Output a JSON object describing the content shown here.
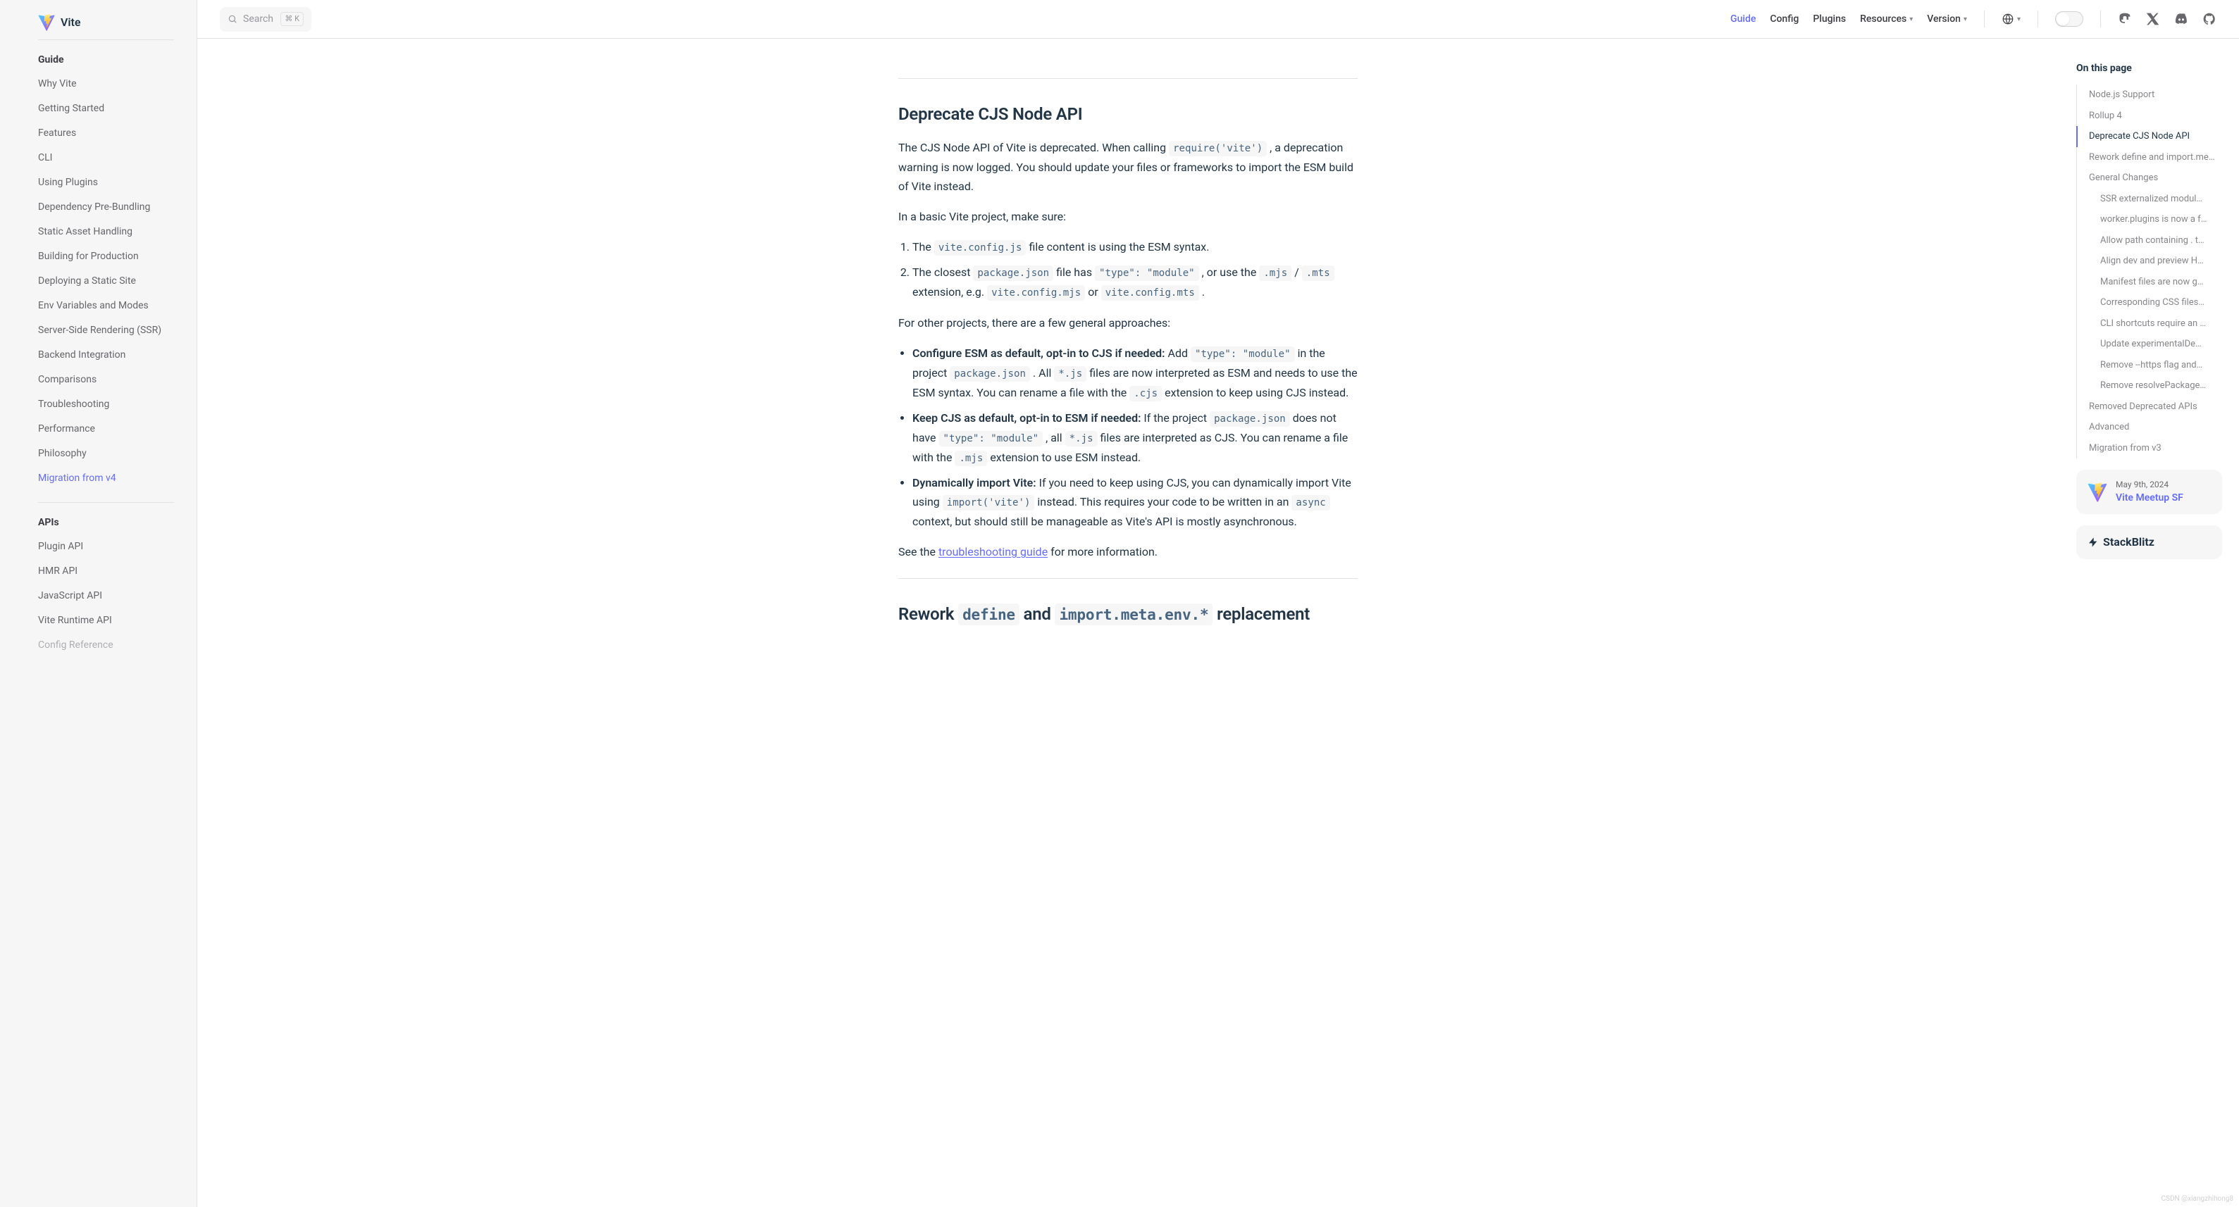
{
  "brand": "Vite",
  "search": {
    "placeholder": "Search",
    "kbd": "⌘ K"
  },
  "topnav": {
    "guide": "Guide",
    "config": "Config",
    "plugins": "Plugins",
    "resources": "Resources",
    "version": "Version"
  },
  "sidebar": {
    "group1": "Guide",
    "items1": [
      "Why Vite",
      "Getting Started",
      "Features",
      "CLI",
      "Using Plugins",
      "Dependency Pre-Bundling",
      "Static Asset Handling",
      "Building for Production",
      "Deploying a Static Site",
      "Env Variables and Modes",
      "Server-Side Rendering (SSR)",
      "Backend Integration",
      "Comparisons",
      "Troubleshooting",
      "Performance",
      "Philosophy",
      "Migration from v4"
    ],
    "active1": 16,
    "group2": "APIs",
    "items2": [
      "Plugin API",
      "HMR API",
      "JavaScript API",
      "Vite Runtime API",
      "Config Reference"
    ]
  },
  "article": {
    "h2a": "Deprecate CJS Node API",
    "p1a": "The CJS Node API of Vite is deprecated. When calling ",
    "p1_code1": "require('vite')",
    "p1b": " , a deprecation warning is now logged. You should update your files or frameworks to import the ESM build of Vite instead.",
    "p2": "In a basic Vite project, make sure:",
    "ol1_a": "The ",
    "ol1_code": "vite.config.js",
    "ol1_b": " file content is using the ESM syntax.",
    "ol2_a": "The closest ",
    "ol2_code1": "package.json",
    "ol2_b": " file has ",
    "ol2_code2": "\"type\": \"module\"",
    "ol2_c": " , or use the ",
    "ol2_code3": ".mjs",
    "ol2_d": " / ",
    "ol2_code4": ".mts",
    "ol2_e": " extension, e.g. ",
    "ol2_code5": "vite.config.mjs",
    "ol2_f": " or ",
    "ol2_code6": "vite.config.mts",
    "ol2_g": " .",
    "p3": "For other projects, there are a few general approaches:",
    "ul1_strong": "Configure ESM as default, opt-in to CJS if needed:",
    "ul1_a": " Add ",
    "ul1_code1": "\"type\": \"module\"",
    "ul1_b": " in the project ",
    "ul1_code2": "package.json",
    "ul1_c": " . All ",
    "ul1_code3": "*.js",
    "ul1_d": " files are now interpreted as ESM and needs to use the ESM syntax. You can rename a file with the ",
    "ul1_code4": ".cjs",
    "ul1_e": " extension to keep using CJS instead.",
    "ul2_strong": "Keep CJS as default, opt-in to ESM if needed:",
    "ul2_a": " If the project ",
    "ul2_code1": "package.json",
    "ul2_b": " does not have ",
    "ul2_code2": "\"type\": \"module\"",
    "ul2_c": " , all ",
    "ul2_code3": "*.js",
    "ul2_d": " files are interpreted as CJS. You can rename a file with the ",
    "ul2_code4": ".mjs",
    "ul2_e": " extension to use ESM instead.",
    "ul3_strong": "Dynamically import Vite:",
    "ul3_a": " If you need to keep using CJS, you can dynamically import Vite using ",
    "ul3_code1": "import('vite')",
    "ul3_b": " instead. This requires your code to be written in an ",
    "ul3_code2": "async",
    "ul3_c": " context, but should still be manageable as Vite's API is mostly asynchronous.",
    "p4a": "See the ",
    "p4_link": "troubleshooting guide",
    "p4b": " for more information.",
    "h2b_a": "Rework ",
    "h2b_code1": "define",
    "h2b_b": " and ",
    "h2b_code2": "import.meta.env.*",
    "h2b_c": " replacement"
  },
  "outline": {
    "title": "On this page",
    "items": [
      {
        "label": "Node.js Support",
        "nested": false,
        "active": false
      },
      {
        "label": "Rollup 4",
        "nested": false,
        "active": false
      },
      {
        "label": "Deprecate CJS Node API",
        "nested": false,
        "active": true
      },
      {
        "label": "Rework define and import.me…",
        "nested": false,
        "active": false
      },
      {
        "label": "General Changes",
        "nested": false,
        "active": false
      },
      {
        "label": "SSR externalized modul…",
        "nested": true,
        "active": false
      },
      {
        "label": "worker.plugins is now a f…",
        "nested": true,
        "active": false
      },
      {
        "label": "Allow path containing . t…",
        "nested": true,
        "active": false
      },
      {
        "label": "Align dev and preview H…",
        "nested": true,
        "active": false
      },
      {
        "label": "Manifest files are now g…",
        "nested": true,
        "active": false
      },
      {
        "label": "Corresponding CSS files…",
        "nested": true,
        "active": false
      },
      {
        "label": "CLI shortcuts require an …",
        "nested": true,
        "active": false
      },
      {
        "label": "Update experimentalDe…",
        "nested": true,
        "active": false
      },
      {
        "label": "Remove --https flag and…",
        "nested": true,
        "active": false
      },
      {
        "label": "Remove resolvePackage…",
        "nested": true,
        "active": false
      },
      {
        "label": "Removed Deprecated APIs",
        "nested": false,
        "active": false
      },
      {
        "label": "Advanced",
        "nested": false,
        "active": false
      },
      {
        "label": "Migration from v3",
        "nested": false,
        "active": false
      }
    ]
  },
  "promo": {
    "date": "May 9th, 2024",
    "title": "Vite Meetup SF",
    "sb": "StackBlitz"
  },
  "watermark": "CSDN @xiangzhihong8"
}
